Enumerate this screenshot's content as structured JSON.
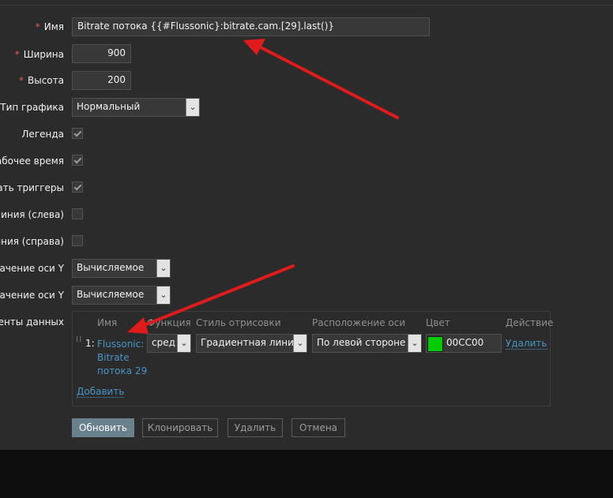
{
  "form": {
    "name_label": "Имя",
    "name_value": "Bitrate потока {{#Flussonic}:bitrate.cam.[29].last()}",
    "width_label": "Ширина",
    "width_value": "900",
    "height_label": "Высота",
    "height_value": "200",
    "graph_type_label": "Тип графика",
    "graph_type_value": "Нормальный",
    "legend_label": "Легенда",
    "worktime_label": "абочее время",
    "triggers_label": "жать триггеры",
    "perc_left_label": "линия (слева)",
    "perc_right_label": "иния (справа)",
    "ymin_label": "начение оси Y",
    "ymin_value": "Вычисляемое",
    "ymax_label": "начение оси Y",
    "ymax_value": "Вычисляемое",
    "items_label": "менты данных"
  },
  "required_mark": "*",
  "items_table": {
    "headers": {
      "name": "Имя",
      "function": "Функция",
      "draw_style": "Стиль отрисовки",
      "axis": "Расположение оси",
      "color": "Цвет",
      "action": "Действие"
    },
    "row": {
      "index": "1:",
      "name_line1": "Flussonic:",
      "name_line2": "Bitrate",
      "name_line3": "потока 29",
      "function": "сред",
      "draw_style": "Градиентная линия",
      "axis": "По левой стороне",
      "color": "00CC00",
      "remove": "Удалить"
    },
    "add": "Добавить"
  },
  "buttons": {
    "update": "Обновить",
    "clone": "Клонировать",
    "delete": "Удалить",
    "cancel": "Отмена"
  },
  "colors": {
    "swatch": "#00CC00",
    "annotation_arrow": "#e01b1b"
  },
  "icons": {
    "select_arrow": "chevron-down-icon",
    "drag": "drag-handle-icon"
  }
}
